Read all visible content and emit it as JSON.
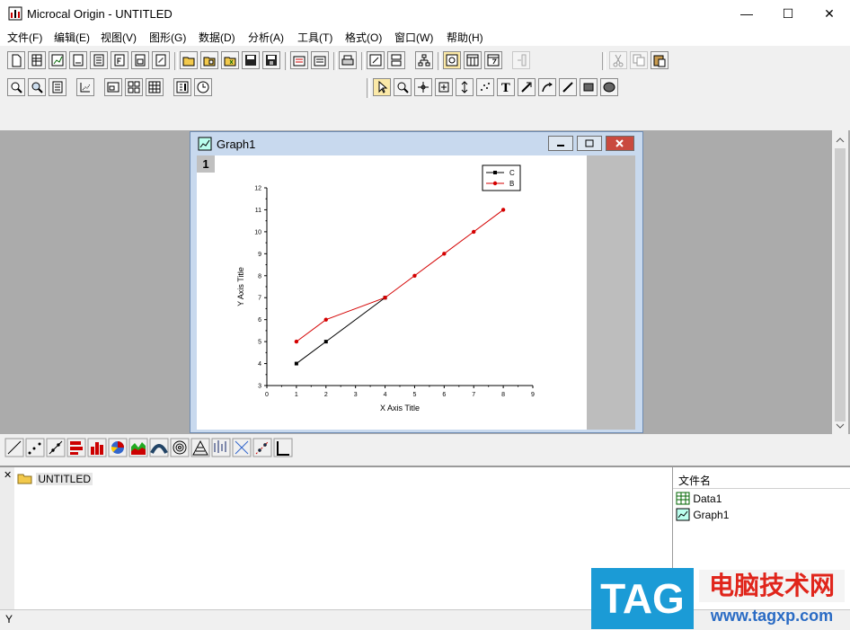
{
  "window": {
    "title": "Microcal Origin - UNTITLED",
    "controls": {
      "minimize": "—",
      "maximize": "☐",
      "close": "✕"
    }
  },
  "menu": [
    "文件(F)",
    "编辑(E)",
    "视图(V)",
    "图形(G)",
    "数据(D)",
    "分析(A)",
    "工具(T)",
    "格式(O)",
    "窗口(W)",
    "帮助(H)"
  ],
  "graph_window": {
    "title": "Graph1",
    "layer_label": "1"
  },
  "chart_data": {
    "type": "line",
    "xlabel": "X Axis Title",
    "ylabel": "Y Axis Title",
    "xlim": [
      0,
      9
    ],
    "ylim": [
      3,
      12
    ],
    "x_ticks": [
      0,
      1,
      2,
      3,
      4,
      5,
      6,
      7,
      8,
      9
    ],
    "y_ticks": [
      3,
      4,
      5,
      6,
      7,
      8,
      9,
      10,
      11,
      12
    ],
    "legend_position": "top-right",
    "series": [
      {
        "name": "C",
        "color": "#000000",
        "marker": "square",
        "x": [
          1,
          2,
          4
        ],
        "y": [
          4,
          5,
          7
        ]
      },
      {
        "name": "B",
        "color": "#d40000",
        "marker": "circle",
        "x": [
          1,
          2,
          4,
          5,
          6,
          7,
          8
        ],
        "y": [
          5,
          6,
          7,
          8,
          9,
          10,
          11
        ]
      }
    ]
  },
  "project_explorer": {
    "folder": "UNTITLED",
    "list_header": "文件名",
    "items": [
      {
        "name": "Data1",
        "icon": "worksheet-icon"
      },
      {
        "name": "Graph1",
        "icon": "graph-icon"
      }
    ]
  },
  "status_bar": {
    "text": "Y"
  },
  "watermark": {
    "logo": "TAG",
    "site_name": "电脑技术网",
    "url": "www.tagxp.com"
  }
}
